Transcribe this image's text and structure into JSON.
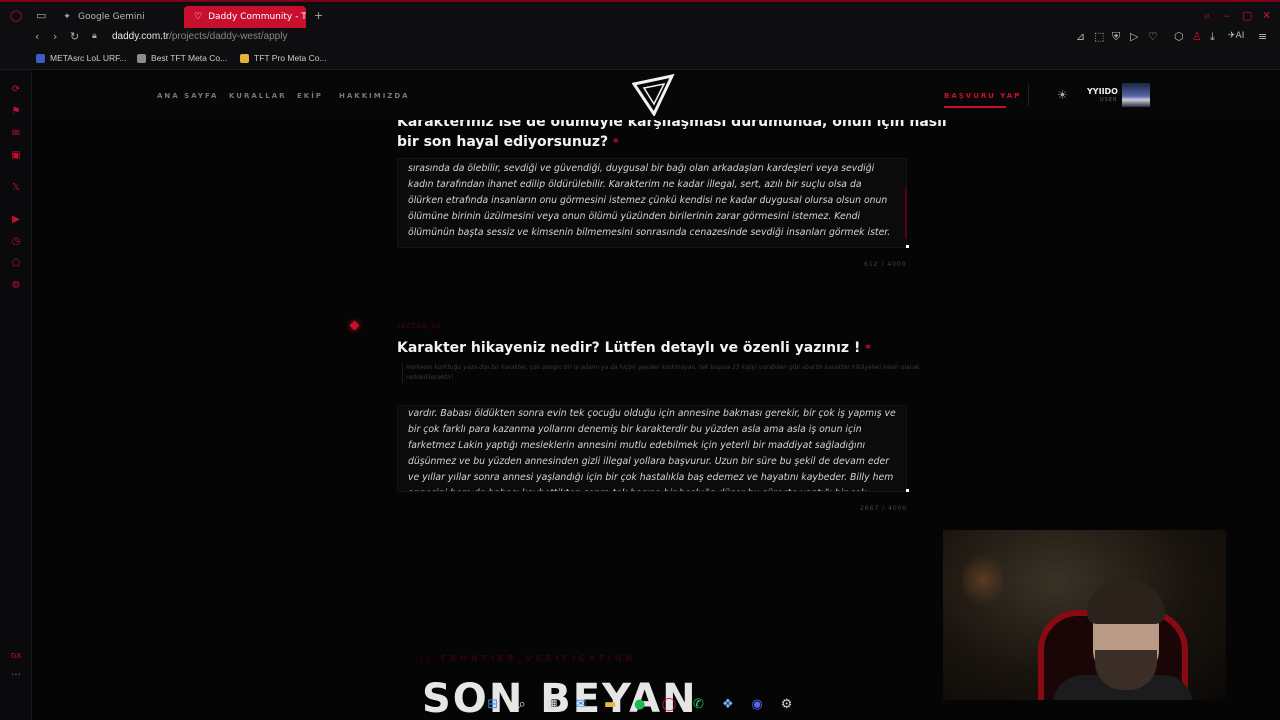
{
  "browser": {
    "tabs": [
      {
        "label": "Google Gemini",
        "icon": "gemini-icon"
      },
      {
        "label": "Daddy Community - Türkiy",
        "icon": "daddy-favicon"
      }
    ],
    "new_tab": "+",
    "url_host": "daddy.com.tr",
    "url_path": "/projects/daddy-west/apply",
    "ai_label": "AI",
    "bookmarks": [
      {
        "label": "METAsrc LoL URF...",
        "color": "#3b5fc0"
      },
      {
        "label": "Best TFT Meta Co...",
        "color": "#8c8c8c"
      },
      {
        "label": "TFT Pro Meta Co...",
        "color": "#e2b33a"
      }
    ],
    "sidebar_bottom": "GX",
    "sidebar_more": "···"
  },
  "nav": {
    "links": [
      "ANA SAYFA",
      "KURALLAR",
      "EKİP",
      "HAKKIMIZDA"
    ],
    "apply": "BAŞVURU YAP",
    "user_name": "YYIIDO",
    "user_role": "USER"
  },
  "form": {
    "q1_title": "Karakteriniz ise de ölümüyle karşılaşması durumunda, onun için nasıl bir son hayal ediyorsunuz?",
    "required_mark": "*",
    "a1": "sırasında da ölebilir, sevdiği ve güvendiği, duygusal bir bağı olan arkadaşları kardeşleri veya sevdiği kadın tarafından ihanet edilip öldürülebilir. Karakterim ne kadar illegal, sert, azılı bir suçlu olsa da ölürken etrafında insanların onu görmesini istemez çünkü kendisi ne kadar duygusal olursa olsun onun ölümüne birinin üzülmesini veya onun ölümü yüzünden birilerinin zarar görmesini istemez. Kendi ölümünün başta sessiz ve kimsenin bilmemesini sonrasında cenazesinde sevdiği insanları görmek ister.",
    "c1": "612 / 4000",
    "step_label": "SECTOR_10",
    "q2_title": "Karakter hikayeniz nedir? Lütfen detaylı ve özenli yazınız !",
    "q2_hint": "Herkesin korktuğu yaza dışı bir karakter, çok zengin bir iş adamı ya da hiçbir şeyden korkmayan, tek başına 15 kişiyi vurabilen gibi abartılı karakter hikâyeleri kesin olarak reddedilecektir!",
    "a2": "vardır. Babası öldükten sonra evin tek çocuğu olduğu için annesine bakması gerekir, bir çok iş yapmış ve bir çok farklı para kazanma yollarını denemiş bir karakterdir bu yüzden asla ama asla iş onun için farketmez Lakin yaptığı mesleklerin annesini mutlu edebilmek için yeterli bir maddiyat sağladığını düşünmez ve bu yüzden annesinden gizli illegal yollara başvurur. Uzun bir süre bu şekil de devam eder ve yıllar yıllar sonra annesi yaşlandığı için bir çok hastalıkla baş edemez ve hayatını kaybeder. Billy hem annesini hem de babası kaybettikten sonra tek başına bir boşluğa düşer bu süreçte yaptığı bir çok illegal",
    "c2": "2667 / 4000",
    "frontier": "// FRONTIER_VERIFICATION",
    "big": "SON BEYAN"
  },
  "taskbar": [
    {
      "name": "windows-start-icon",
      "glyph": "⊞",
      "color": "#3a8ee6"
    },
    {
      "name": "search-icon",
      "glyph": "⌕",
      "color": "#ddd"
    },
    {
      "name": "store-icon",
      "glyph": "▦",
      "color": "#ddd"
    },
    {
      "name": "mail-icon",
      "glyph": "✉",
      "color": "#3a8ee6"
    },
    {
      "name": "folder-icon",
      "glyph": "▬",
      "color": "#e8b844"
    },
    {
      "name": "spotify-icon",
      "glyph": "●",
      "color": "#1db954"
    },
    {
      "name": "opera-gx-icon",
      "glyph": "◯",
      "color": "#e3123c"
    },
    {
      "name": "whatsapp-icon",
      "glyph": "✆",
      "color": "#25d366"
    },
    {
      "name": "app-icon",
      "glyph": "❖",
      "color": "#7fb3ff"
    },
    {
      "name": "discord-icon",
      "glyph": "◉",
      "color": "#5865f2"
    },
    {
      "name": "steam-icon",
      "glyph": "⚙",
      "color": "#c7d5e0"
    }
  ]
}
